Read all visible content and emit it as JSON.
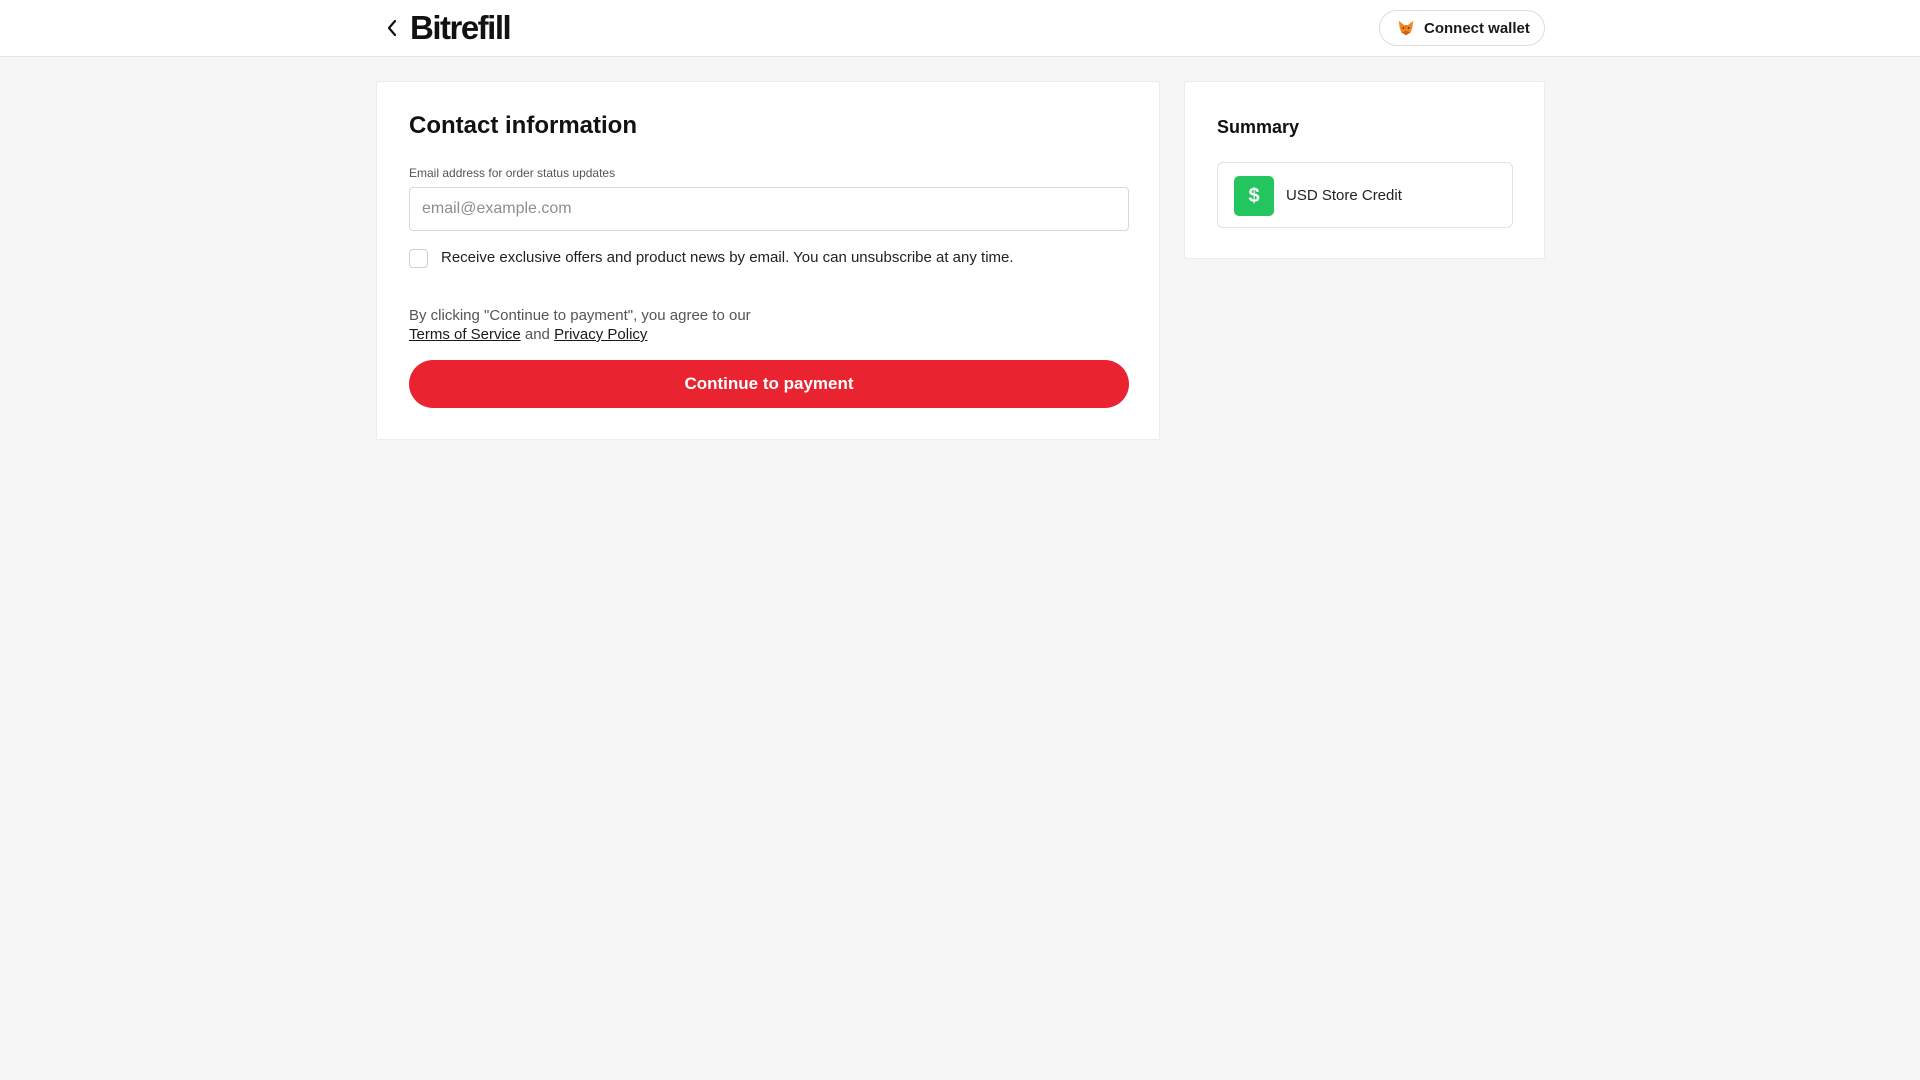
{
  "header": {
    "logo_text": "Bitrefill",
    "connect_wallet_label": "Connect wallet"
  },
  "contact": {
    "title": "Contact information",
    "email_label": "Email address for order status updates",
    "email_placeholder": "email@example.com",
    "email_value": "",
    "newsletter_label": "Receive exclusive offers and product news by email. You can unsubscribe at any time.",
    "newsletter_checked": false,
    "terms_prefix": "By clicking \"Continue to payment\", you agree to our ",
    "terms_link": "Terms of Service",
    "terms_and": " and ",
    "privacy_link": "Privacy Policy",
    "continue_label": "Continue to payment"
  },
  "summary": {
    "title": "Summary",
    "item_icon": "$",
    "item_label": "USD Store Credit"
  },
  "colors": {
    "accent": "#e92330",
    "credit_badge": "#22c55e"
  },
  "icons": {
    "back": "chevron-left-icon",
    "wallet": "fox-icon"
  }
}
